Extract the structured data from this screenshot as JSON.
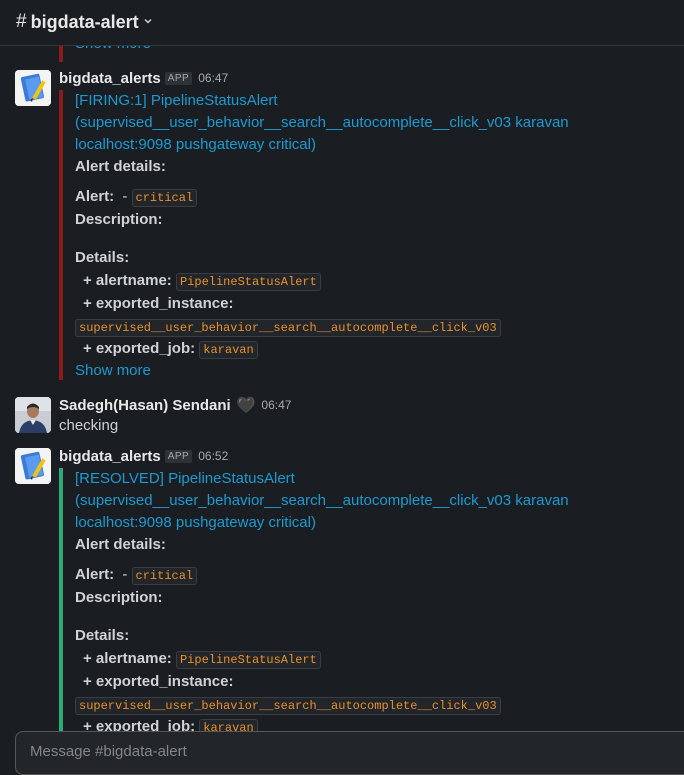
{
  "header": {
    "hash": "#",
    "channel": "bigdata-alert",
    "chevron": "⌄"
  },
  "leftover": {
    "show_more": "Show more"
  },
  "messages": [
    {
      "sender": "bigdata_alerts",
      "badge": "APP",
      "time": "06:47",
      "bar_color": "#8e1b1b",
      "title_line1": "[FIRING:1] PipelineStatusAlert",
      "title_line2": "(supervised__user_behavior__search__autocomplete__click_v03 karavan",
      "title_line3": "localhost:9098 pushgateway critical)",
      "alert_details": "Alert details:",
      "alert_label": "Alert:",
      "alert_dash": "-",
      "alert_severity": "critical",
      "description_label": "Description:",
      "details_label": "Details:",
      "alertname_label": "+ alertname:",
      "alertname_value": "PipelineStatusAlert",
      "instance_label": "+ exported_instance:",
      "instance_value": "supervised__user_behavior__search__autocomplete__click_v03",
      "job_label": "+ exported_job:",
      "job_value": "karavan",
      "show_more": "Show more"
    },
    {
      "sender": "Sadegh(Hasan) Sendani",
      "status_icon": "🖤",
      "time": "06:47",
      "text": "checking"
    },
    {
      "sender": "bigdata_alerts",
      "badge": "APP",
      "time": "06:52",
      "bar_color": "#2bac76",
      "title_line1": "[RESOLVED] PipelineStatusAlert",
      "title_line2": "(supervised__user_behavior__search__autocomplete__click_v03 karavan",
      "title_line3": "localhost:9098 pushgateway critical)",
      "alert_details": "Alert details:",
      "alert_label": "Alert:",
      "alert_dash": "-",
      "alert_severity": "critical",
      "description_label": "Description:",
      "details_label": "Details:",
      "alertname_label": "+ alertname:",
      "alertname_value": "PipelineStatusAlert",
      "instance_label": "+ exported_instance:",
      "instance_value": "supervised__user_behavior__search__autocomplete__click_v03",
      "job_label": "+ exported_job:",
      "job_value": "karavan"
    }
  ],
  "composer": {
    "placeholder": "Message #bigdata-alert"
  }
}
